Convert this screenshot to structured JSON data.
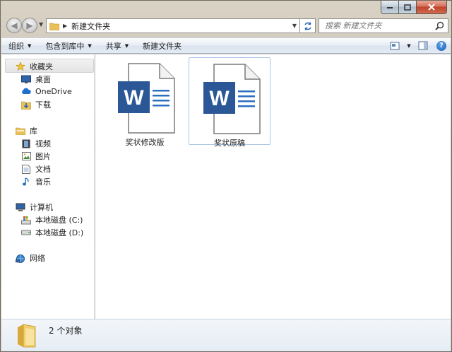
{
  "address": {
    "path": "新建文件夹"
  },
  "search": {
    "placeholder": "搜索 新建文件夹"
  },
  "toolbar": {
    "organize": "组织",
    "include_in_library": "包含到库中",
    "share": "共享",
    "new_folder": "新建文件夹"
  },
  "sidebar": {
    "favorites": "收藏夹",
    "desktop": "桌面",
    "onedrive": "OneDrive",
    "downloads": "下载",
    "libraries": "库",
    "videos": "视频",
    "pictures": "图片",
    "documents": "文档",
    "music": "音乐",
    "computer": "计算机",
    "disk_c": "本地磁盘 (C:)",
    "disk_d": "本地磁盘 (D:)",
    "network": "网络"
  },
  "files": [
    {
      "name": "奖状修改版",
      "icon": "word-document-icon",
      "selected": false
    },
    {
      "name": "奖状原稿",
      "icon": "word-document-icon",
      "selected": true
    }
  ],
  "status": {
    "count": "2 个对象"
  },
  "colors": {
    "word_blue": "#2b5797",
    "selection_border": "#a8c4e4"
  }
}
